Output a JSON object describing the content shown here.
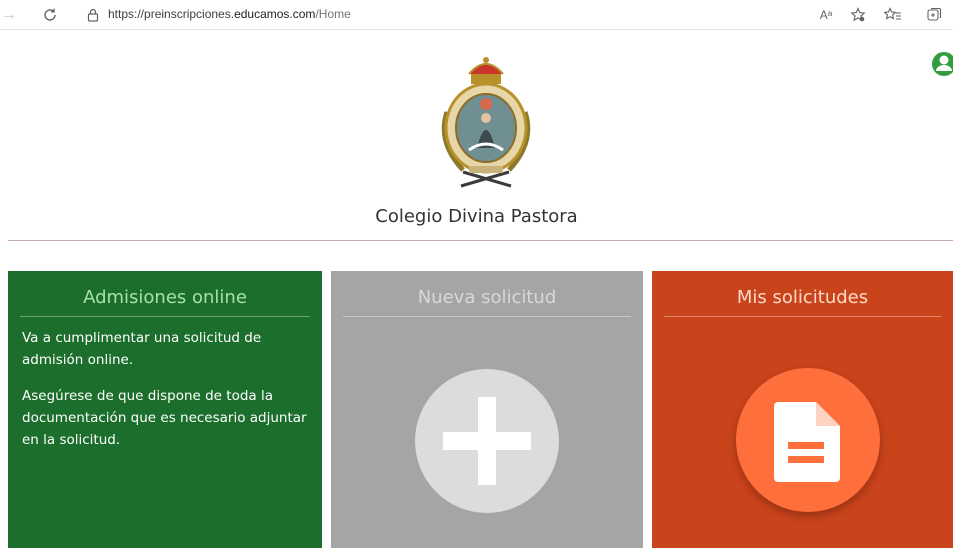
{
  "browser": {
    "url_prefix": "https://preinscripciones.",
    "url_host": "educamos.com",
    "url_path": "/Home",
    "read_aloud_label": "Aᵃ"
  },
  "header": {
    "school_name": "Colegio Divina Pastora"
  },
  "cards": {
    "admissions": {
      "title": "Admisiones online",
      "paragraph1": "Va a cumplimentar una solicitud de admisión online.",
      "paragraph2": "Asegúrese de que dispone de toda la documentación que es necesario adjuntar en la solicitud."
    },
    "new_request": {
      "title": "Nueva solicitud",
      "icon": "plus-icon"
    },
    "my_requests": {
      "title": "Mis solicitudes",
      "icon": "document-icon"
    }
  },
  "colors": {
    "green_card": "#1b6e2b",
    "gray_card": "#a5a5a5",
    "orange_card": "#c9431b",
    "doc_circle": "#ff6f3c",
    "user_icon": "#2e9e3e"
  }
}
